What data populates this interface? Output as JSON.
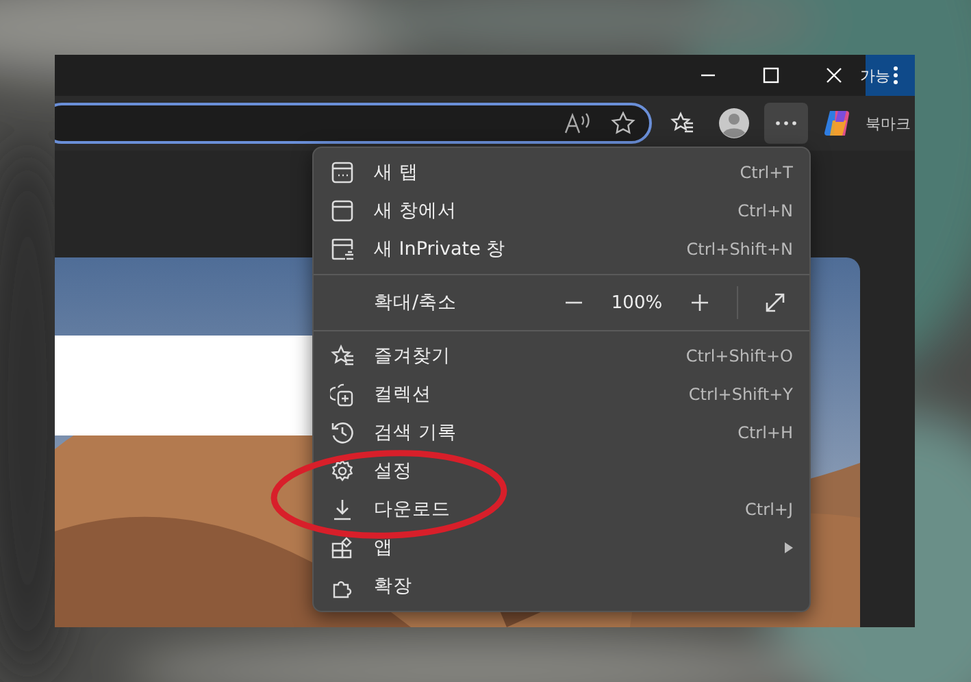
{
  "side_window": {
    "title": "가능",
    "toolbar_label": "북마크"
  },
  "zoom": {
    "label": "확대/축소",
    "value": "100%"
  },
  "menu": {
    "groups": [
      [
        {
          "label": "새 탭",
          "shortcut": "Ctrl+T",
          "submenu": false
        },
        {
          "label": "새 창에서",
          "shortcut": "Ctrl+N",
          "submenu": false
        },
        {
          "label": "새 InPrivate 창",
          "shortcut": "Ctrl+Shift+N",
          "submenu": false
        }
      ],
      [
        {
          "label": "즐겨찾기",
          "shortcut": "Ctrl+Shift+O",
          "submenu": false
        },
        {
          "label": "컬렉션",
          "shortcut": "Ctrl+Shift+Y",
          "submenu": false
        },
        {
          "label": "검색 기록",
          "shortcut": "Ctrl+H",
          "submenu": false
        },
        {
          "label": "설정",
          "submenu": false
        },
        {
          "label": "다운로드",
          "shortcut": "Ctrl+J",
          "submenu": false
        },
        {
          "label": "앱",
          "submenu": true
        },
        {
          "label": "확장",
          "submenu": false
        }
      ]
    ]
  }
}
